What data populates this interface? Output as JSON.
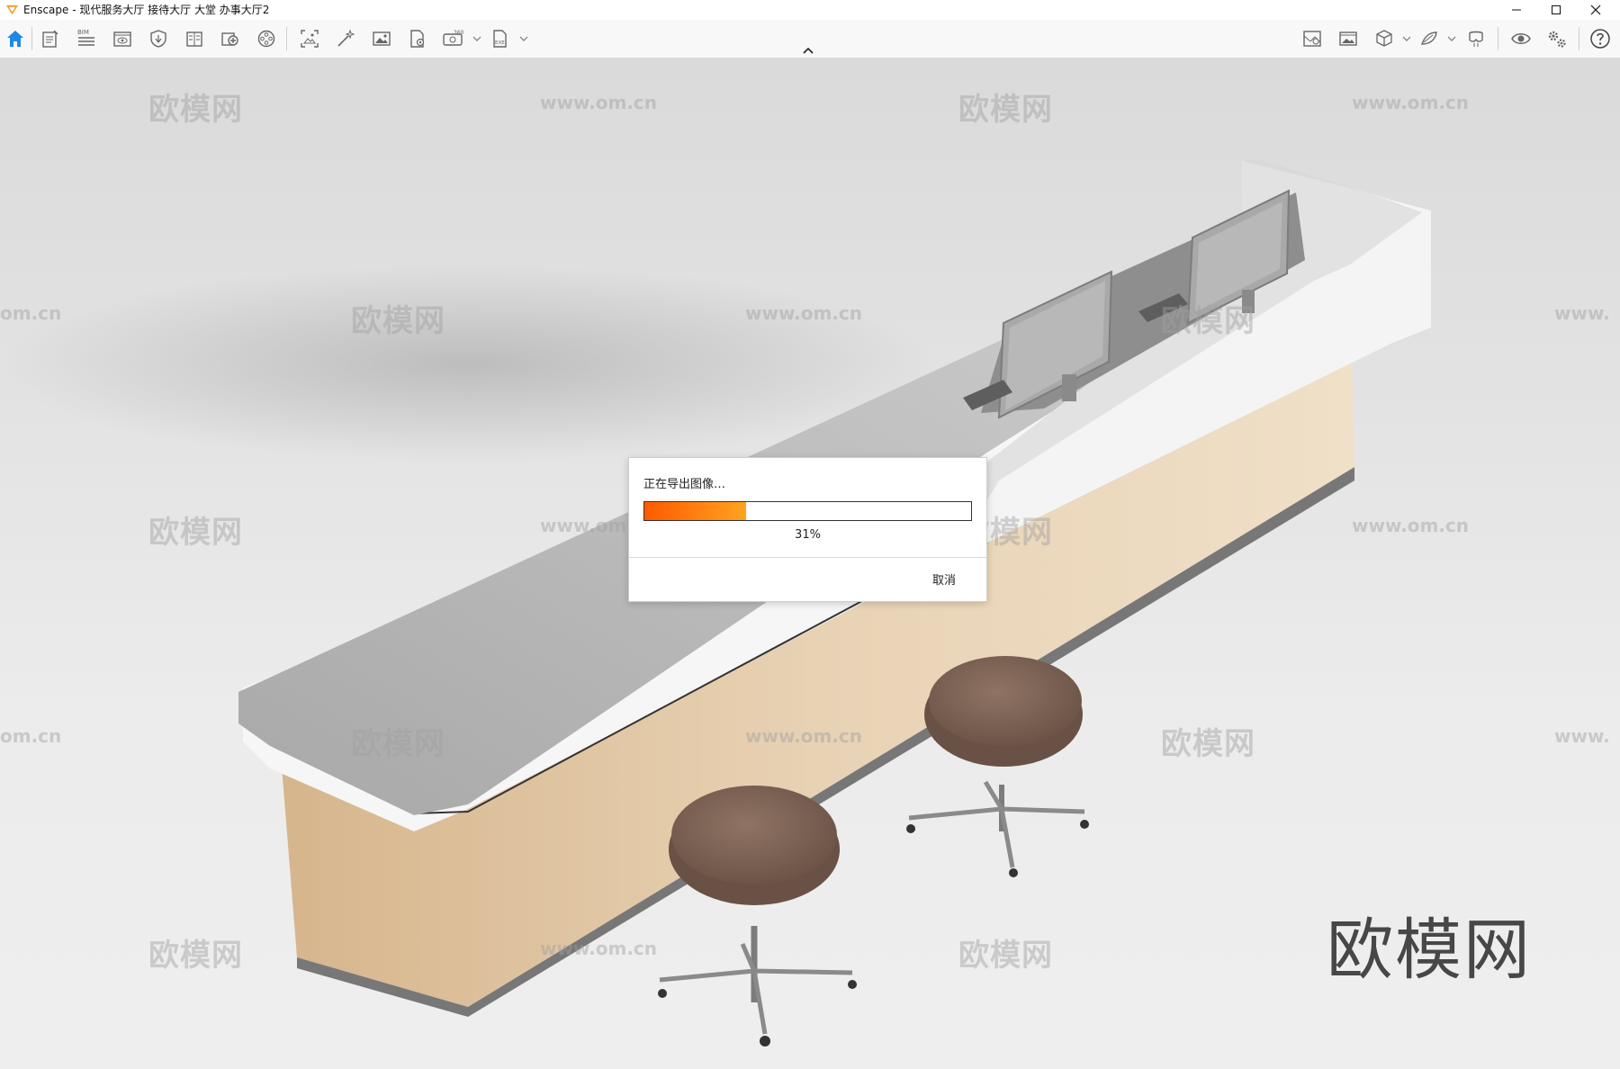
{
  "window": {
    "title": "Enscape - 现代服务大厅 接待大厅 大堂 办事大厅2"
  },
  "toolbar": {
    "left_icons": [
      "home-icon",
      "document-icon",
      "bim-icon",
      "eye-frame-icon",
      "shield-icon",
      "book-icon",
      "camera-add-icon",
      "film-reel-icon",
      "screenshot-icon",
      "magic-wand-icon",
      "image-icon",
      "file-settings-icon",
      "panorama-360-icon",
      "exe-export-icon"
    ],
    "right_icons": [
      "map-icon",
      "image-gallery-icon",
      "cube-icon",
      "atlas-icon",
      "vr-headset-icon",
      "eye-icon",
      "settings-icon",
      "help-icon"
    ],
    "bim_label": "BIM",
    "panorama_label": "360",
    "exe_label": "EXE"
  },
  "viewport": {
    "watermark_text": "欧模网",
    "watermark_url": "www.om.cn",
    "watermark_partial": "om.cn",
    "watermark_partial_left": "www."
  },
  "dialog": {
    "message": "正在导出图像…",
    "progress_percent": 31,
    "progress_label": "31%",
    "cancel_label": "取消",
    "accent_colors": [
      "#ff5a00",
      "#ffa31e"
    ]
  }
}
